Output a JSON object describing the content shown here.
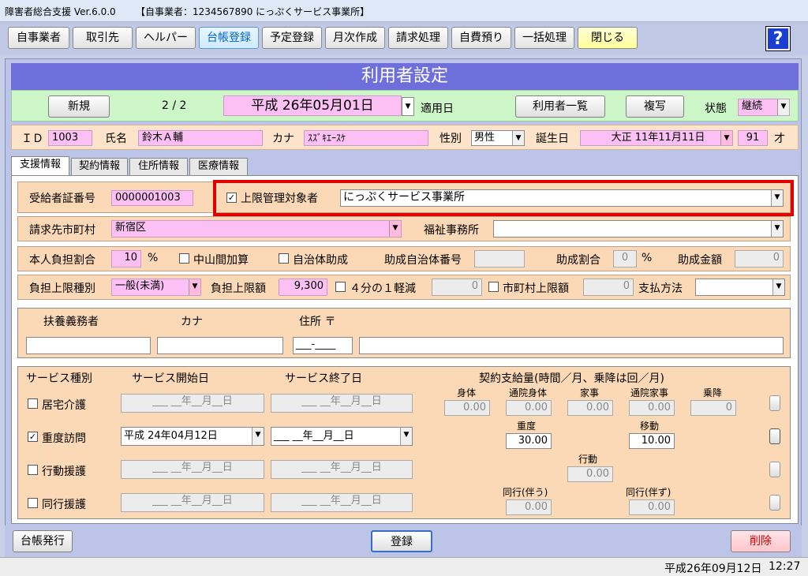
{
  "window": {
    "title": "障害者総合支援 Ver.6.0.0",
    "office": "【自事業者：1234567890 にっぷくサービス事業所】"
  },
  "toolbar": {
    "buttons": [
      "自事業者",
      "取引先",
      "ヘルパー",
      "台帳登録",
      "予定登録",
      "月次作成",
      "請求処理",
      "自費預り",
      "一括処理",
      "閉じる"
    ],
    "help": "?"
  },
  "header": {
    "title": "利用者設定"
  },
  "record": {
    "new_label": "新規",
    "page": "2 / 2",
    "apply_date": "平成 26年05月01日",
    "apply_label": "適用日",
    "list_label": "利用者一覧",
    "copy_label": "複写",
    "status_label": "状態",
    "status_value": "継続"
  },
  "person": {
    "id_label": "ＩＤ",
    "id": "1003",
    "name_label": "氏名",
    "name": "鈴木Ａ輔",
    "kana_label": "カナ",
    "kana": "ｽｽﾞｷｴｰｽｹ",
    "sex_label": "性別",
    "sex": "男性",
    "birth_label": "誕生日",
    "birth": "大正 11年11月11日",
    "age": "91",
    "age_unit": "才"
  },
  "tabs": [
    "支援情報",
    "契約情報",
    "住所情報",
    "医療情報"
  ],
  "support": {
    "cert_label": "受給者証番号",
    "cert": "0000001003",
    "limit_mgmt_label": "上限管理対象者",
    "limit_mgmt_value": "にっぷくサービス事業所",
    "city_label": "請求先市町村",
    "city": "新宿区",
    "welfare_label": "福祉事務所",
    "welfare": "",
    "ratio_label": "本人負担割合",
    "ratio": "10",
    "pct": "%",
    "mid_label": "中山間加算",
    "local_label": "自治体助成",
    "local_no_label": "助成自治体番号",
    "aid_ratio_label": "助成割合",
    "aid_ratio": "0",
    "aid_amount_label": "助成金額",
    "aid_amount": "0",
    "limit_type_label": "負担上限種別",
    "limit_type": "一般(未満)",
    "limit_amount_label": "負担上限額",
    "limit_amount": "9,300",
    "quarter_label": "４分の１軽減",
    "quarter_value": "0",
    "city_limit_label": "市町村上限額",
    "city_limit_value": "0",
    "pay_label": "支払方法",
    "pay_value": ""
  },
  "guardian": {
    "label": "扶養義務者",
    "kana": "カナ",
    "address": "住所 〒",
    "zip": "___-____"
  },
  "services": {
    "col_type": "サービス種別",
    "col_start": "サービス開始日",
    "col_end": "サービス終了日",
    "col_amount": "契約支給量(時間／月、乗降は回／月)",
    "empty_date": "___ __年__月__日",
    "rows": [
      {
        "name": "居宅介護",
        "checked": false,
        "start": "___ __年__月__日",
        "end": "___ __年__月__日"
      },
      {
        "name": "重度訪問",
        "checked": true,
        "start": "平成 24年04月12日",
        "end": "___ __年__月__日"
      },
      {
        "name": "行動援護",
        "checked": false,
        "start": "___ __年__月__日",
        "end": "___ __年__月__日"
      },
      {
        "name": "同行援護",
        "checked": false,
        "start": "___ __年__月__日",
        "end": "___ __年__月__日"
      }
    ],
    "r1": {
      "l1": "身体",
      "v1": "0.00",
      "l2": "通院身体",
      "v2": "0.00",
      "l3": "家事",
      "v3": "0.00",
      "l4": "通院家事",
      "v4": "0.00",
      "l5": "乗降",
      "v5": "0"
    },
    "r2": {
      "l1": "重度",
      "v1": "30.00",
      "l2": "移動",
      "v2": "10.00"
    },
    "r3": {
      "l1": "行動",
      "v1": "0.00"
    },
    "r4": {
      "l1": "同行(伴う)",
      "v1": "0.00",
      "l2": "同行(伴ず)",
      "v2": "0.00"
    }
  },
  "footer": {
    "ledger": "台帳発行",
    "register": "登録",
    "delete": "削除"
  },
  "status": {
    "date": "平成26年09月12日",
    "time": "12:27"
  }
}
